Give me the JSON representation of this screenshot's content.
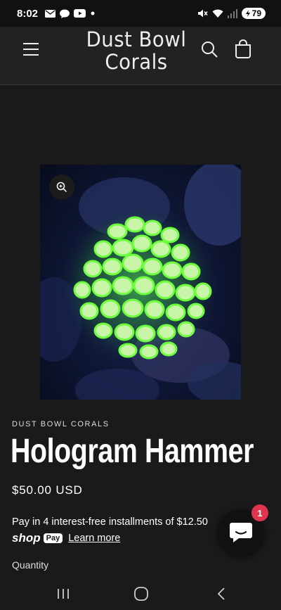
{
  "status_bar": {
    "time": "8:02",
    "battery": "79",
    "icons": [
      "mail-icon",
      "chat-icon",
      "youtube-icon",
      "dot-icon",
      "mute-icon",
      "wifi-icon",
      "signal-icon",
      "battery-icon"
    ]
  },
  "header": {
    "logo_line1": "Dust Bowl",
    "logo_line2": "Corals",
    "icons": [
      "menu-icon",
      "search-icon",
      "cart-icon"
    ]
  },
  "product": {
    "vendor": "DUST BOWL CORALS",
    "title": "Hologram Hammer",
    "price": "$50.00 USD",
    "installments_text": "Pay in 4 interest-free installments of $12.50",
    "shop_word": "shop",
    "pay_badge": "Pay",
    "learn_more": "Learn more",
    "quantity_label": "Quantity"
  },
  "chat": {
    "badge_count": "1"
  },
  "colors": {
    "background": "#1a1a1a",
    "header": "#222222",
    "badge": "#e1344f",
    "coral": "#9dff7a"
  }
}
